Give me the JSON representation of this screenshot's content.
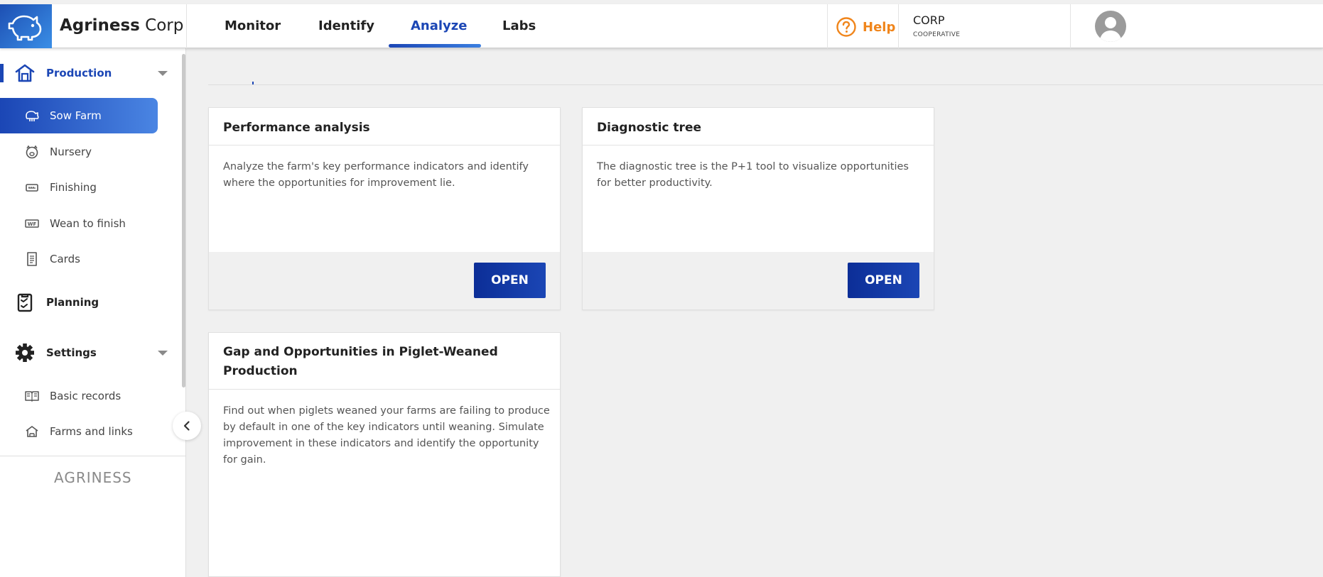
{
  "header": {
    "brand_strong": "Agriness",
    "brand_rest": "Corp",
    "tabs": [
      {
        "label": "Monitor"
      },
      {
        "label": "Identify"
      },
      {
        "label": "Analyze"
      },
      {
        "label": "Labs"
      }
    ],
    "active_tab": "Analyze",
    "help_label": "Help",
    "org_name": "CORP",
    "org_type": "COOPERATIVE",
    "icons": [
      "pig-logo-icon",
      "help-circle-icon",
      "avatar-icon"
    ]
  },
  "sidebar": {
    "production": {
      "label": "Production",
      "icon": "barn-icon",
      "items": [
        {
          "label": "Sow Farm",
          "icon": "sow-icon",
          "active": true
        },
        {
          "label": "Nursery",
          "icon": "piglet-icon"
        },
        {
          "label": "Finishing",
          "icon": "scale-icon"
        },
        {
          "label": "Wean to finish",
          "icon": "wf-icon"
        },
        {
          "label": "Cards",
          "icon": "document-icon"
        }
      ]
    },
    "planning": {
      "label": "Planning",
      "icon": "clipboard-check-icon"
    },
    "settings": {
      "label": "Settings",
      "icon": "gear-icon",
      "items": [
        {
          "label": "Basic records",
          "icon": "book-icon"
        },
        {
          "label": "Farms and links",
          "icon": "farm-icon"
        }
      ]
    },
    "footer_brand": "AGRINESS"
  },
  "cards": [
    {
      "title": "Performance analysis",
      "description": "Analyze the farm's key performance indicators and identify where the opportunities for improvement lie.",
      "button": "OPEN"
    },
    {
      "title": "Diagnostic tree",
      "description": "The diagnostic tree is the P+1 tool to visualize opportunities for better productivity.",
      "button": "OPEN"
    },
    {
      "title": "Gap and Opportunities in Piglet-Weaned Production",
      "description": "Find out when piglets weaned your farms are failing to produce by default in one of the key indicators until weaning. Simulate improvement in these indicators and identify the opportunity for gain."
    }
  ],
  "colors": {
    "primary": "#1b46b5",
    "help_orange": "#f0851b",
    "background": "#f0f0f0"
  }
}
